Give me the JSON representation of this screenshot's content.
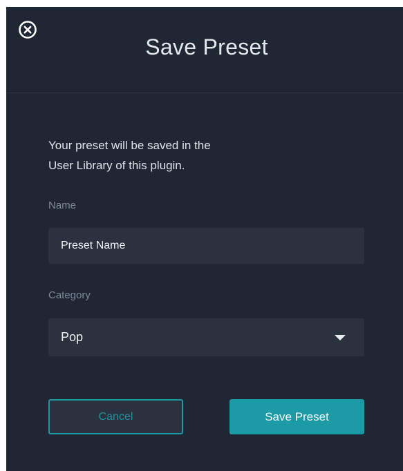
{
  "dialog": {
    "title": "Save Preset",
    "close_icon": "close-circle-icon",
    "description_line1": "Your preset will be saved in the",
    "description_line2": "User Library of this plugin.",
    "name_label": "Name",
    "name_value": "Preset Name",
    "category_label": "Category",
    "category_value": "Pop",
    "dropdown_icon": "caret-down-icon",
    "cancel_label": "Cancel",
    "save_label": "Save Preset"
  },
  "colors": {
    "background": "#1f2734",
    "input_background": "#2a3240",
    "accent": "#1c9aa5",
    "text": "#e6e9ee",
    "muted_text": "#7f8896"
  }
}
